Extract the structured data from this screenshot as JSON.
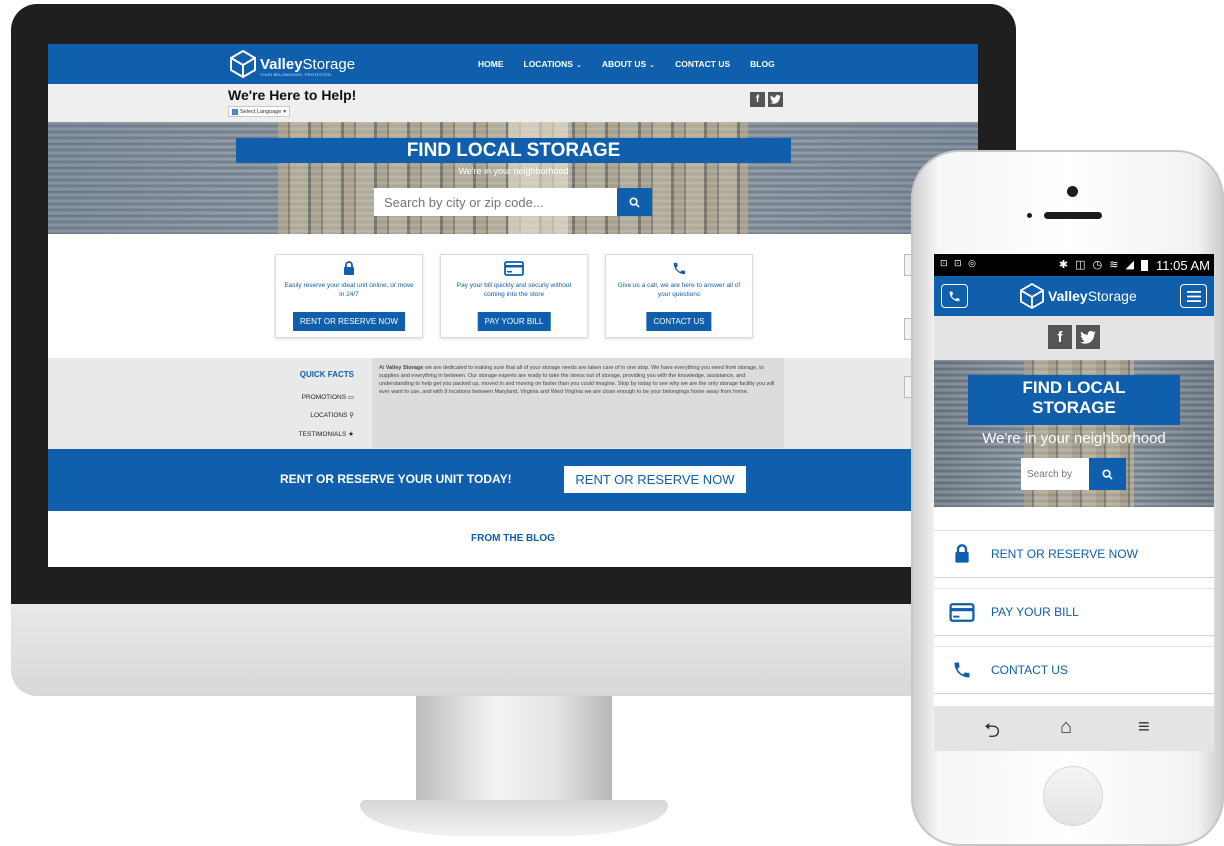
{
  "colors": {
    "brand_blue": "#0f5fad",
    "bezel": "#1f1f1f",
    "light_gray": "#efefef"
  },
  "desktop": {
    "logo": {
      "name_bold": "Valley",
      "name_rest": "Storage",
      "tagline": "YOUR BELONGINGS. PROTECTED."
    },
    "nav": [
      {
        "label": "HOME",
        "dropdown": false
      },
      {
        "label": "LOCATIONS",
        "dropdown": true
      },
      {
        "label": "ABOUT US",
        "dropdown": true
      },
      {
        "label": "CONTACT US",
        "dropdown": false
      },
      {
        "label": "BLOG",
        "dropdown": false
      }
    ],
    "help_title": "We're Here to Help!",
    "language_select": "Select Language",
    "social": {
      "facebook": "f",
      "twitter": "twitter-icon"
    },
    "hero": {
      "title": "FIND LOCAL STORAGE",
      "subtitle": "We're in your neighborhood",
      "search_placeholder": "Search by city or zip code..."
    },
    "cards": [
      {
        "icon": "lock-icon",
        "text": "Easily reserve your ideal unit online, or move in 24/7",
        "button": "RENT OR RESERVE NOW"
      },
      {
        "icon": "credit-card-icon",
        "text": "Pay your bill quickly and securly without coming into the store",
        "button": "PAY YOUR BILL"
      },
      {
        "icon": "phone-icon",
        "text": "Give us a call, we are here to answer all of your questions",
        "button": "CONTACT US"
      }
    ],
    "quick_facts": {
      "title": "QUICK FACTS",
      "items": [
        {
          "label": "PROMOTIONS",
          "icon": "ticket-icon"
        },
        {
          "label": "LOCATIONS",
          "icon": "map-pin-icon"
        },
        {
          "label": "TESTIMONIALS",
          "icon": "star-icon"
        }
      ]
    },
    "about": {
      "prefix": "At ",
      "brand": "Valley Storage",
      "text": " we are dedicated to making sure that all of your storage needs are taken care of in one stop. We have everything you need from storage, to supplies and everything in between. Our storage experts are ready to take the stress out of storage, providing you with the knowledge, assistance, and understanding to help get you packed up, moved in and moving on faster than you could imagine. Stop by today to see why we are the only storage facility you will ever want to use, and with 9 locations between Maryland, Virginia and West Virginia we are close enough to be your belongings home away from home."
    },
    "cta": {
      "text": "RENT OR RESERVE YOUR UNIT TODAY!",
      "button": "RENT OR RESERVE NOW"
    },
    "blog_heading": "FROM THE BLOG"
  },
  "mobile": {
    "status": {
      "left_icons": "⊡ ⊡ ◎",
      "time": "11:05 AM"
    },
    "logo": {
      "name_bold": "Valley",
      "name_rest": "Storage"
    },
    "hero": {
      "title_line1": "FIND LOCAL",
      "title_line2": "STORAGE",
      "subtitle": "We're in your neighborhood",
      "search_placeholder": "Search by"
    },
    "list": [
      {
        "icon": "lock-icon",
        "label": "RENT OR RESERVE NOW"
      },
      {
        "icon": "credit-card-icon",
        "label": "PAY YOUR BILL"
      },
      {
        "icon": "phone-icon",
        "label": "CONTACT US"
      }
    ]
  }
}
